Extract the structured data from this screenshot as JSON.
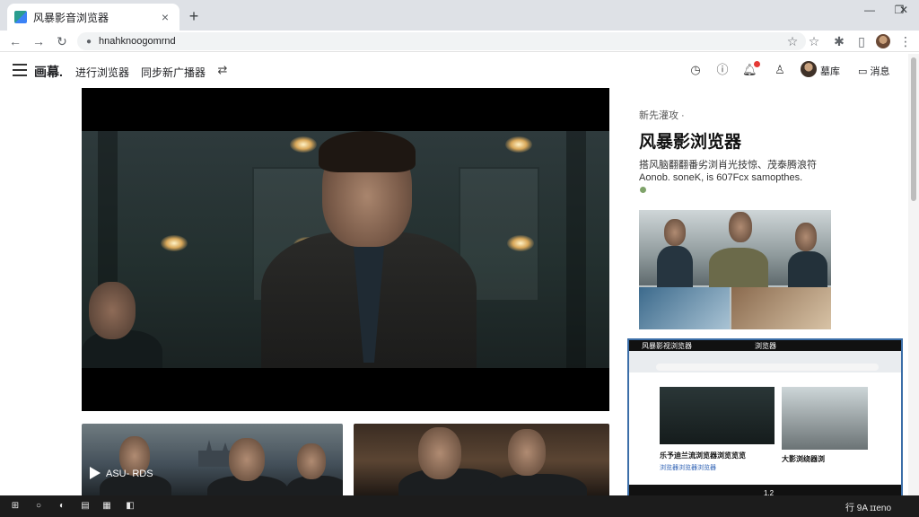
{
  "browser": {
    "tab_title": "风暴影音浏览器",
    "tab_close": "×",
    "new_tab": "+",
    "url": "hnahknoogomrnd",
    "window_controls": [
      "—",
      "❐",
      "✕"
    ]
  },
  "site": {
    "brand": "画幕.",
    "nav": [
      "进行浏览器",
      "同步新广播器"
    ],
    "user_name": "墓库",
    "header_action": "消息",
    "icons": [
      "clock-icon",
      "info-icon",
      "bell-icon",
      "user-icon",
      "chat-icon"
    ]
  },
  "player": {
    "thumbnail_caption": "ASU- RDS"
  },
  "sidebar": {
    "section_label": "新先灌攻 ·",
    "title": "风暴影浏览器",
    "desc_line1": "搭风脑翻翻番劣浏肖光技惊、茂泰腾浪符",
    "desc_line2": "Aonob. soneK, is 607Fcx samopthes.",
    "meta": ""
  },
  "pip": {
    "title": "风暴影视浏览器",
    "badge": "浏览器",
    "caption1": "乐予迪兰流浏览器浏览览览",
    "caption2": "大影浏绕器浏",
    "link": "浏览器浏览器浏览器",
    "footer": "1.2"
  },
  "taskbar": {
    "tray": "行 9A ɪɪeno"
  },
  "colors": {
    "accent": "#3b6ea8",
    "notification": "#e53935",
    "tab_strip": "#dee1e6"
  }
}
